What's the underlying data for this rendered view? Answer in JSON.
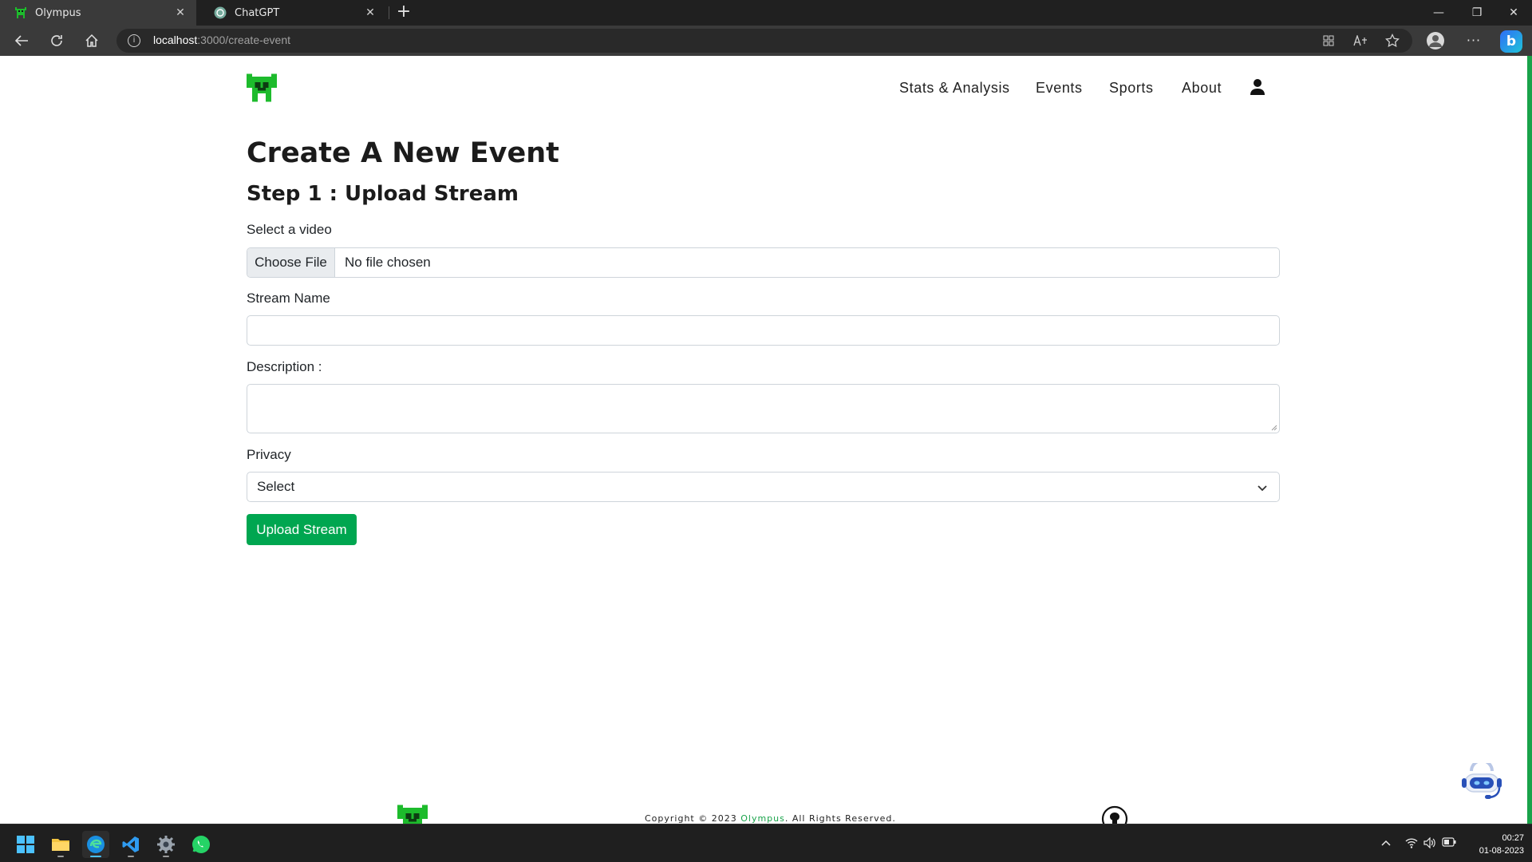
{
  "browser": {
    "tabs": [
      {
        "title": "Olympus",
        "active": true,
        "close": "✕"
      },
      {
        "title": "ChatGPT",
        "active": false,
        "close": "✕"
      }
    ],
    "new_tab": "+",
    "window_controls": {
      "minimize": "—",
      "restore": "❐",
      "close": "✕"
    },
    "url": {
      "host": "localhost",
      "path": ":3000/create-event"
    },
    "more_label": "···",
    "bing_label": "b"
  },
  "site": {
    "nav": [
      "Stats & Analysis",
      "Events",
      "Sports",
      "About"
    ],
    "brand_color": "#00a650"
  },
  "form": {
    "title": "Create A New Event",
    "step": "Step 1 : Upload Stream",
    "video_label": "Select a video",
    "file_button": "Choose File",
    "file_status": "No file chosen",
    "stream_name_label": "Stream Name",
    "stream_name_value": "",
    "description_label": "Description :",
    "description_value": "",
    "privacy_label": "Privacy",
    "privacy_selected": "Select",
    "submit_label": "Upload Stream"
  },
  "footer": {
    "copyright_prefix": "Copyright © 2023 ",
    "brand": "Olympus",
    "copyright_suffix": ". All Rights Reserved."
  },
  "taskbar": {
    "apps": [
      "start-icon",
      "file-explorer-icon",
      "edge-icon",
      "vscode-icon",
      "settings-icon",
      "whatsapp-icon"
    ],
    "time": "00:27",
    "date": "01-08-2023"
  }
}
